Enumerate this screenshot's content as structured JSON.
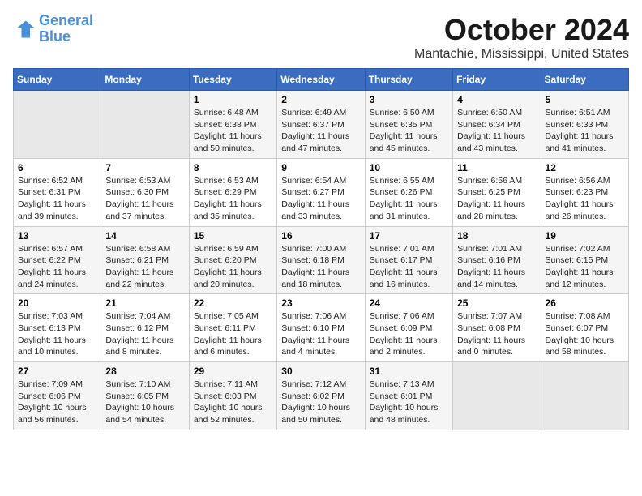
{
  "logo": {
    "line1": "General",
    "line2": "Blue"
  },
  "title": "October 2024",
  "location": "Mantachie, Mississippi, United States",
  "headers": [
    "Sunday",
    "Monday",
    "Tuesday",
    "Wednesday",
    "Thursday",
    "Friday",
    "Saturday"
  ],
  "weeks": [
    [
      {
        "day": "",
        "content": ""
      },
      {
        "day": "",
        "content": ""
      },
      {
        "day": "1",
        "content": "Sunrise: 6:48 AM\nSunset: 6:38 PM\nDaylight: 11 hours and 50 minutes."
      },
      {
        "day": "2",
        "content": "Sunrise: 6:49 AM\nSunset: 6:37 PM\nDaylight: 11 hours and 47 minutes."
      },
      {
        "day": "3",
        "content": "Sunrise: 6:50 AM\nSunset: 6:35 PM\nDaylight: 11 hours and 45 minutes."
      },
      {
        "day": "4",
        "content": "Sunrise: 6:50 AM\nSunset: 6:34 PM\nDaylight: 11 hours and 43 minutes."
      },
      {
        "day": "5",
        "content": "Sunrise: 6:51 AM\nSunset: 6:33 PM\nDaylight: 11 hours and 41 minutes."
      }
    ],
    [
      {
        "day": "6",
        "content": "Sunrise: 6:52 AM\nSunset: 6:31 PM\nDaylight: 11 hours and 39 minutes."
      },
      {
        "day": "7",
        "content": "Sunrise: 6:53 AM\nSunset: 6:30 PM\nDaylight: 11 hours and 37 minutes."
      },
      {
        "day": "8",
        "content": "Sunrise: 6:53 AM\nSunset: 6:29 PM\nDaylight: 11 hours and 35 minutes."
      },
      {
        "day": "9",
        "content": "Sunrise: 6:54 AM\nSunset: 6:27 PM\nDaylight: 11 hours and 33 minutes."
      },
      {
        "day": "10",
        "content": "Sunrise: 6:55 AM\nSunset: 6:26 PM\nDaylight: 11 hours and 31 minutes."
      },
      {
        "day": "11",
        "content": "Sunrise: 6:56 AM\nSunset: 6:25 PM\nDaylight: 11 hours and 28 minutes."
      },
      {
        "day": "12",
        "content": "Sunrise: 6:56 AM\nSunset: 6:23 PM\nDaylight: 11 hours and 26 minutes."
      }
    ],
    [
      {
        "day": "13",
        "content": "Sunrise: 6:57 AM\nSunset: 6:22 PM\nDaylight: 11 hours and 24 minutes."
      },
      {
        "day": "14",
        "content": "Sunrise: 6:58 AM\nSunset: 6:21 PM\nDaylight: 11 hours and 22 minutes."
      },
      {
        "day": "15",
        "content": "Sunrise: 6:59 AM\nSunset: 6:20 PM\nDaylight: 11 hours and 20 minutes."
      },
      {
        "day": "16",
        "content": "Sunrise: 7:00 AM\nSunset: 6:18 PM\nDaylight: 11 hours and 18 minutes."
      },
      {
        "day": "17",
        "content": "Sunrise: 7:01 AM\nSunset: 6:17 PM\nDaylight: 11 hours and 16 minutes."
      },
      {
        "day": "18",
        "content": "Sunrise: 7:01 AM\nSunset: 6:16 PM\nDaylight: 11 hours and 14 minutes."
      },
      {
        "day": "19",
        "content": "Sunrise: 7:02 AM\nSunset: 6:15 PM\nDaylight: 11 hours and 12 minutes."
      }
    ],
    [
      {
        "day": "20",
        "content": "Sunrise: 7:03 AM\nSunset: 6:13 PM\nDaylight: 11 hours and 10 minutes."
      },
      {
        "day": "21",
        "content": "Sunrise: 7:04 AM\nSunset: 6:12 PM\nDaylight: 11 hours and 8 minutes."
      },
      {
        "day": "22",
        "content": "Sunrise: 7:05 AM\nSunset: 6:11 PM\nDaylight: 11 hours and 6 minutes."
      },
      {
        "day": "23",
        "content": "Sunrise: 7:06 AM\nSunset: 6:10 PM\nDaylight: 11 hours and 4 minutes."
      },
      {
        "day": "24",
        "content": "Sunrise: 7:06 AM\nSunset: 6:09 PM\nDaylight: 11 hours and 2 minutes."
      },
      {
        "day": "25",
        "content": "Sunrise: 7:07 AM\nSunset: 6:08 PM\nDaylight: 11 hours and 0 minutes."
      },
      {
        "day": "26",
        "content": "Sunrise: 7:08 AM\nSunset: 6:07 PM\nDaylight: 10 hours and 58 minutes."
      }
    ],
    [
      {
        "day": "27",
        "content": "Sunrise: 7:09 AM\nSunset: 6:06 PM\nDaylight: 10 hours and 56 minutes."
      },
      {
        "day": "28",
        "content": "Sunrise: 7:10 AM\nSunset: 6:05 PM\nDaylight: 10 hours and 54 minutes."
      },
      {
        "day": "29",
        "content": "Sunrise: 7:11 AM\nSunset: 6:03 PM\nDaylight: 10 hours and 52 minutes."
      },
      {
        "day": "30",
        "content": "Sunrise: 7:12 AM\nSunset: 6:02 PM\nDaylight: 10 hours and 50 minutes."
      },
      {
        "day": "31",
        "content": "Sunrise: 7:13 AM\nSunset: 6:01 PM\nDaylight: 10 hours and 48 minutes."
      },
      {
        "day": "",
        "content": ""
      },
      {
        "day": "",
        "content": ""
      }
    ]
  ]
}
